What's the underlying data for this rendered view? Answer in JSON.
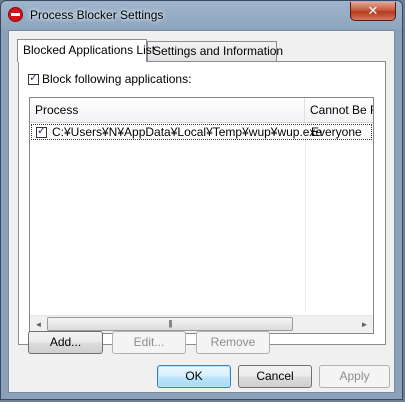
{
  "window": {
    "title": "Process Blocker Settings",
    "close_label": "✕",
    "title_icon": "stop-icon"
  },
  "tabs": [
    {
      "label": "Blocked Applications List",
      "active": true
    },
    {
      "label": "Settings and Information",
      "active": false
    }
  ],
  "block_option": {
    "label": "Block following applications:",
    "checked": true
  },
  "list": {
    "columns": [
      "Process",
      "Cannot Be Run By"
    ],
    "rows": [
      {
        "checked": true,
        "process": "C:¥Users¥N¥AppData¥Local¥Temp¥wup¥wup.exe",
        "user": "Everyone"
      }
    ],
    "scroll_left_icon": "◄",
    "scroll_right_icon": "►",
    "scroll_thumb_grip": "|||"
  },
  "list_buttons": {
    "add": "Add...",
    "edit": "Edit...",
    "remove": "Remove"
  },
  "dialog_buttons": {
    "ok": "OK",
    "cancel": "Cancel",
    "apply": "Apply"
  }
}
